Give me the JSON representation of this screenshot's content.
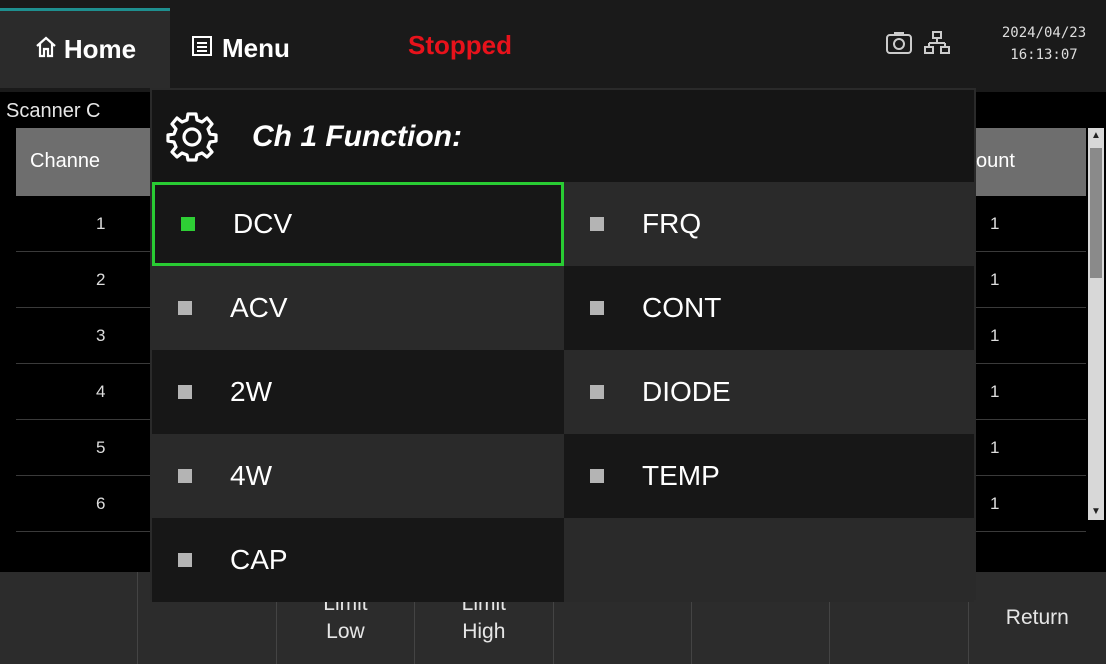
{
  "header": {
    "home_label": "Home",
    "menu_label": "Menu",
    "status": "Stopped",
    "date": "2024/04/23",
    "time": "16:13:07",
    "colors": {
      "status": "#e8121b",
      "accent_green": "#2ecf35"
    }
  },
  "scanner": {
    "title": "Scanner C",
    "col_channel": "Channe",
    "col_count": "ount",
    "rows": [
      {
        "channel": "1",
        "count": "1"
      },
      {
        "channel": "2",
        "count": "1"
      },
      {
        "channel": "3",
        "count": "1"
      },
      {
        "channel": "4",
        "count": "1"
      },
      {
        "channel": "5",
        "count": "1"
      },
      {
        "channel": "6",
        "count": "1"
      }
    ]
  },
  "dialog": {
    "title": "Ch 1 Function:",
    "options": [
      {
        "label": "DCV",
        "selected": true
      },
      {
        "label": "FRQ",
        "selected": false
      },
      {
        "label": "ACV",
        "selected": false
      },
      {
        "label": "CONT",
        "selected": false
      },
      {
        "label": "2W",
        "selected": false
      },
      {
        "label": "DIODE",
        "selected": false
      },
      {
        "label": "4W",
        "selected": false
      },
      {
        "label": "TEMP",
        "selected": false
      },
      {
        "label": "CAP",
        "selected": false
      }
    ]
  },
  "softkeys": [
    {
      "line1": "",
      "line2": ""
    },
    {
      "line1": "",
      "line2": ""
    },
    {
      "line1": "Limit",
      "line2": "Low"
    },
    {
      "line1": "Limit",
      "line2": "High"
    },
    {
      "line1": "",
      "line2": ""
    },
    {
      "line1": "",
      "line2": ""
    },
    {
      "line1": "",
      "line2": ""
    },
    {
      "line1": "Return",
      "line2": ""
    }
  ],
  "icons": {
    "home": "home-icon",
    "menu": "menu-icon",
    "camera": "camera-icon",
    "network": "network-icon",
    "gear": "gear-icon"
  }
}
